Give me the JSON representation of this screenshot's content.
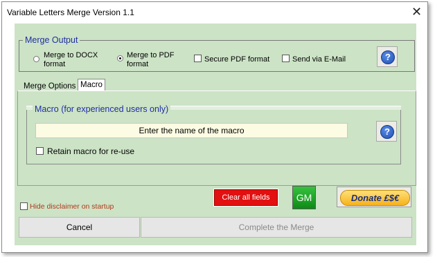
{
  "window": {
    "title": "Variable Letters Merge Version 1.1"
  },
  "merge_output": {
    "legend": "Merge Output",
    "option_docx": {
      "line1": "Merge to DOCX",
      "line2": "format",
      "selected": false
    },
    "option_pdf": {
      "line1": "Merge to PDF",
      "line2": "format",
      "selected": true
    },
    "secure_pdf": {
      "label": "Secure PDF format",
      "checked": false
    },
    "send_email": {
      "label": "Send via E-Mail",
      "checked": false
    },
    "help_glyph": "?"
  },
  "tabs": [
    {
      "label": "Merge Options",
      "active": false
    },
    {
      "label": "Macro",
      "active": true
    }
  ],
  "macro": {
    "legend": "Macro (for experienced users only)",
    "input_placeholder": "Enter the name of the macro",
    "retain_label": "Retain macro for re-use",
    "retain_checked": false,
    "help_glyph": "?"
  },
  "buttons": {
    "clear_all": "Clear all fields",
    "gm": "GM",
    "donate": "Donate £$€",
    "cancel": "Cancel",
    "complete": "Complete the Merge"
  },
  "hide_disclaimer": {
    "label": "Hide disclaimer on startup",
    "checked": false
  },
  "colors": {
    "panel_bg": "#cce3c6",
    "legend_text": "#1f2fa0",
    "clear_button": "#e21010",
    "gm_button": "#1ea326",
    "donate_pill": "#f6b21b",
    "disclaimer_text": "#b23a1a"
  }
}
